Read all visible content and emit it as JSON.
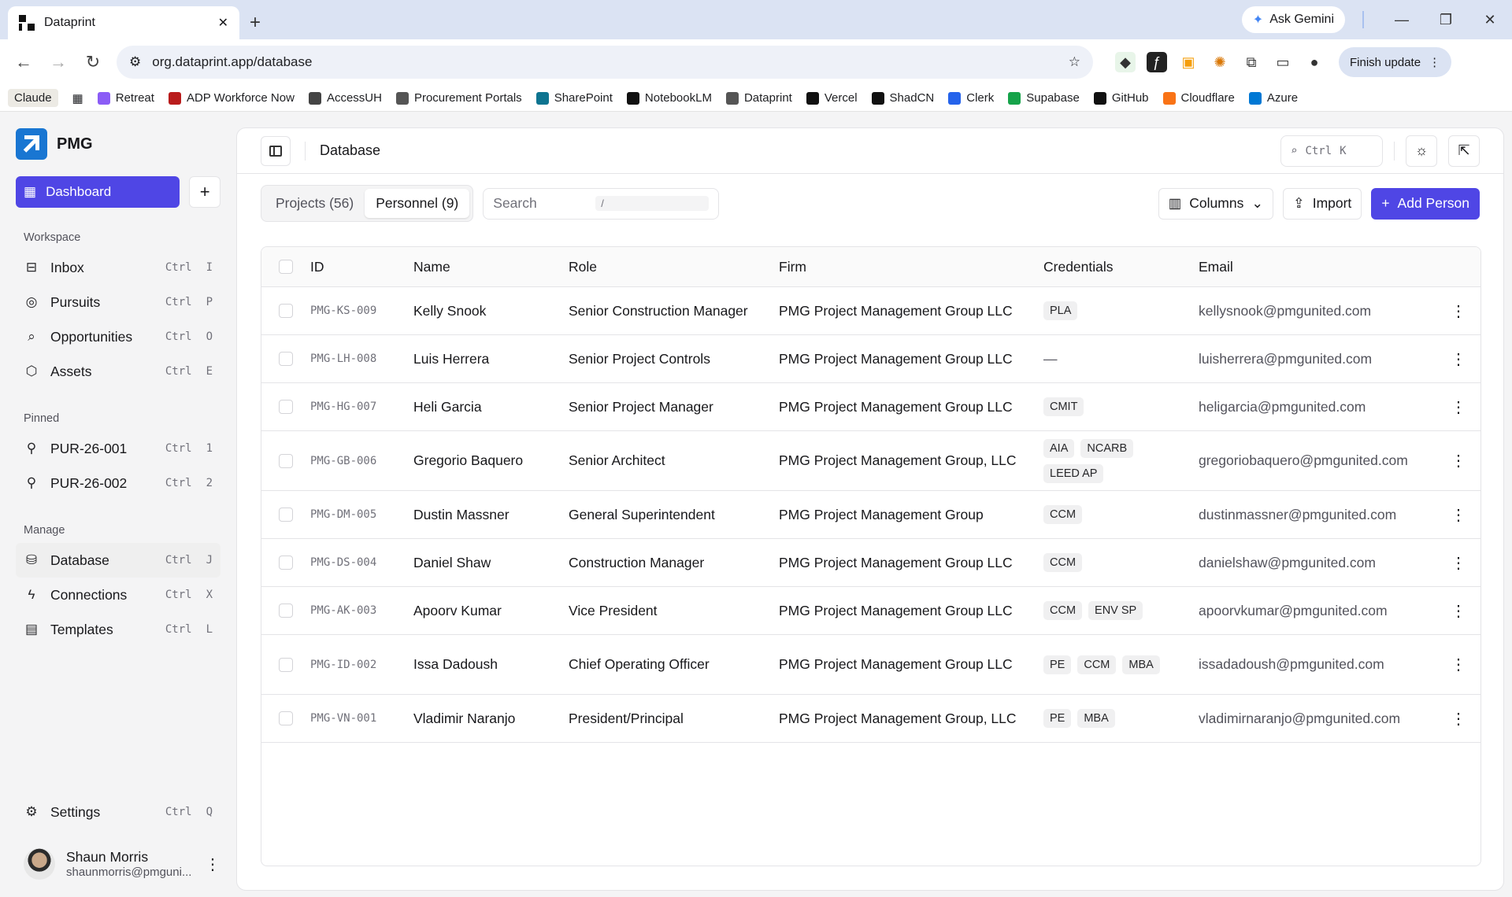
{
  "browser": {
    "tab_title": "Dataprint",
    "url": "org.dataprint.app/database",
    "ask_gemini": "Ask Gemini",
    "finish_update": "Finish update",
    "bookmarks": [
      "Claude",
      "Retreat",
      "ADP Workforce Now",
      "AccessUH",
      "Procurement Portals",
      "SharePoint",
      "NotebookLM",
      "Dataprint",
      "Vercel",
      "ShadCN",
      "Clerk",
      "Supabase",
      "GitHub",
      "Cloudflare",
      "Azure"
    ]
  },
  "sidebar": {
    "brand": "PMG",
    "dashboard": "Dashboard",
    "sections": {
      "workspace": "Workspace",
      "pinned": "Pinned",
      "manage": "Manage"
    },
    "workspace": [
      {
        "label": "Inbox",
        "key": "I"
      },
      {
        "label": "Pursuits",
        "key": "P"
      },
      {
        "label": "Opportunities",
        "key": "O"
      },
      {
        "label": "Assets",
        "key": "E"
      }
    ],
    "pinned": [
      {
        "label": "PUR-26-001",
        "key": "1"
      },
      {
        "label": "PUR-26-002",
        "key": "2"
      }
    ],
    "manage": [
      {
        "label": "Database",
        "key": "J"
      },
      {
        "label": "Connections",
        "key": "X"
      },
      {
        "label": "Templates",
        "key": "L"
      }
    ],
    "ctrl": "Ctrl",
    "settings": {
      "label": "Settings",
      "key": "Q"
    },
    "user": {
      "name": "Shaun Morris",
      "email": "shaunmorris@pmguni..."
    }
  },
  "main": {
    "title": "Database",
    "cmdk": {
      "ctrl": "Ctrl",
      "key": "K"
    },
    "tabs": [
      "Projects (56)",
      "Personnel (9)"
    ],
    "search_placeholder": "Search",
    "search_key": "/",
    "columns_btn": "Columns",
    "import_btn": "Import",
    "add_btn": "Add Person",
    "headers": [
      "ID",
      "Name",
      "Role",
      "Firm",
      "Credentials",
      "Email"
    ],
    "rows": [
      {
        "id": "PMG-KS-009",
        "name": "Kelly Snook",
        "role": "Senior Construction Manager",
        "firm": "PMG Project Management Group LLC",
        "creds": [
          "PLA"
        ],
        "email": "kellysnook@pmgunited.com"
      },
      {
        "id": "PMG-LH-008",
        "name": "Luis Herrera",
        "role": "Senior Project Controls",
        "firm": "PMG Project Management Group LLC",
        "creds": [],
        "email": "luisherrera@pmgunited.com"
      },
      {
        "id": "PMG-HG-007",
        "name": "Heli Garcia",
        "role": "Senior Project Manager",
        "firm": "PMG Project Management Group LLC",
        "creds": [
          "CMIT"
        ],
        "email": "heligarcia@pmgunited.com"
      },
      {
        "id": "PMG-GB-006",
        "name": "Gregorio Baquero",
        "role": "Senior Architect",
        "firm": "PMG Project Management Group, LLC",
        "creds": [
          "AIA",
          "NCARB",
          "LEED AP"
        ],
        "email": "gregoriobaquero@pmgunited.com"
      },
      {
        "id": "PMG-DM-005",
        "name": "Dustin Massner",
        "role": "General Superintendent",
        "firm": "PMG Project Management Group",
        "creds": [
          "CCM"
        ],
        "email": "dustinmassner@pmgunited.com"
      },
      {
        "id": "PMG-DS-004",
        "name": "Daniel Shaw",
        "role": "Construction Manager",
        "firm": "PMG Project Management Group LLC",
        "creds": [
          "CCM"
        ],
        "email": "danielshaw@pmgunited.com"
      },
      {
        "id": "PMG-AK-003",
        "name": "Apoorv Kumar",
        "role": "Vice President",
        "firm": "PMG Project Management Group LLC",
        "creds": [
          "CCM",
          "ENV SP"
        ],
        "email": "apoorvkumar@pmgunited.com"
      },
      {
        "id": "PMG-ID-002",
        "name": "Issa Dadoush",
        "role": "Chief Operating Officer",
        "firm": "PMG Project Management Group LLC",
        "creds": [
          "PE",
          "CCM",
          "MBA"
        ],
        "email": "issadadoush@pmgunited.com"
      },
      {
        "id": "PMG-VN-001",
        "name": "Vladimir Naranjo",
        "role": "President/Principal",
        "firm": "PMG Project Management Group, LLC",
        "creds": [
          "PE",
          "MBA"
        ],
        "email": "vladimirnaranjo@pmgunited.com"
      }
    ],
    "empty_cred": "—"
  },
  "colors": {
    "accent": "#4f46e5",
    "brand": "#1976d2"
  }
}
